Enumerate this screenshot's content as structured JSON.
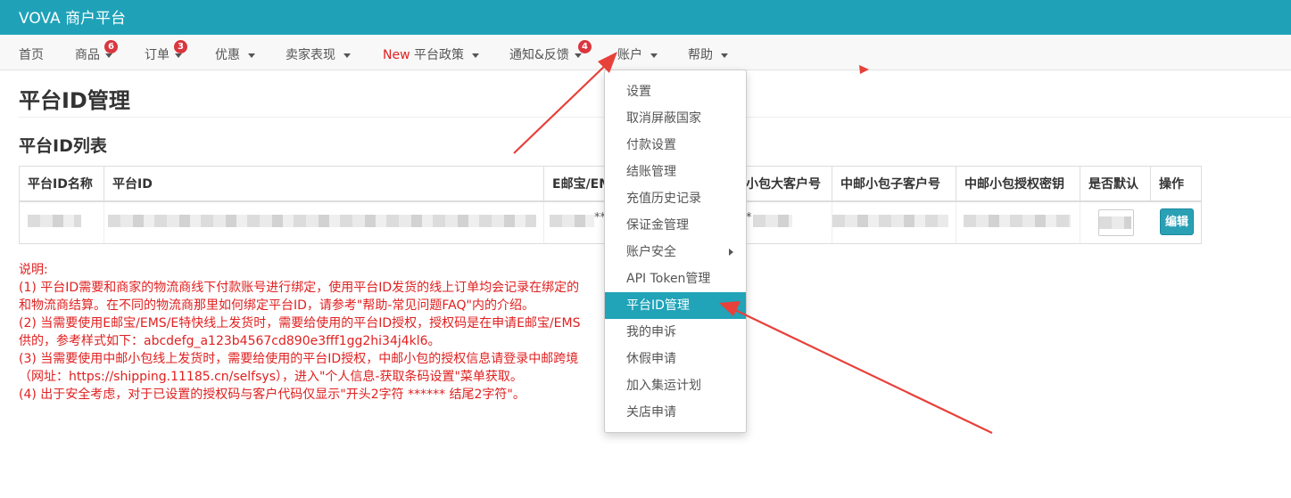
{
  "brand": "VOVA 商户平台",
  "nav": {
    "home": "首页",
    "products": "商品",
    "products_badge": "6",
    "orders": "订单",
    "orders_badge": "3",
    "promotions": "优惠",
    "seller_performance": "卖家表现",
    "policy_new": "New",
    "policy": "平台政策",
    "notices": "通知&反馈",
    "notices_badge": "4",
    "account": "账户",
    "help": "帮助"
  },
  "page_title": "平台ID管理",
  "section_title": "平台ID列表",
  "table": {
    "headers": [
      "平台ID名称",
      "平台ID",
      "E邮宝/EMS",
      "中邮小包大客户号",
      "中邮小包子客户号",
      "中邮小包授权密钥",
      "是否默认",
      "操作"
    ],
    "visible_headers": [
      "平台ID名称",
      "平台ID",
      "E邮宝/EM",
      "小包大客户号",
      "中邮小包子客户号",
      "中邮小包授权密钥",
      "是否默认",
      "操作"
    ],
    "masked_e": "**",
    "masked_big": "*",
    "edit_label": "编辑"
  },
  "notes": [
    "说明:",
    "(1) 平台ID需要和商家的物流商线下付款账号进行绑定，使用平台ID发货的线上订单均会记录在绑定的",
    "和物流商结算。在不同的物流商那里如何绑定平台ID，请参考\"帮助-常见问题FAQ\"内的介绍。",
    "(2) 当需要使用E邮宝/EMS/E特快线上发货时，需要给使用的平台ID授权，授权码是在申请E邮宝/EMS",
    "供的，参考样式如下：abcdefg_a123b4567cd890e3fff1gg2hi34j4kl6。",
    "(3) 当需要使用中邮小包线上发货时，需要给使用的平台ID授权，中邮小包的授权信息请登录中邮跨境",
    "（网址：https://shipping.11185.cn/selfsys），进入\"个人信息-获取条码设置\"菜单获取。",
    "(4) 出于安全考虑，对于已设置的授权码与客户代码仅显示\"开头2字符 ****** 结尾2字符\"。"
  ],
  "account_menu": [
    "设置",
    "取消屏蔽国家",
    "付款设置",
    "结账管理",
    "充值历史记录",
    "保证金管理",
    "账户安全",
    "API Token管理",
    "平台ID管理",
    "我的申诉",
    "休假申请",
    "加入集运计划",
    "关店申请"
  ],
  "colors": {
    "topbar": "#1fa2b8",
    "active_menu": "#21a3b8",
    "note_text": "#e02020",
    "badge": "#d9363e",
    "arrow": "#e8403a"
  }
}
